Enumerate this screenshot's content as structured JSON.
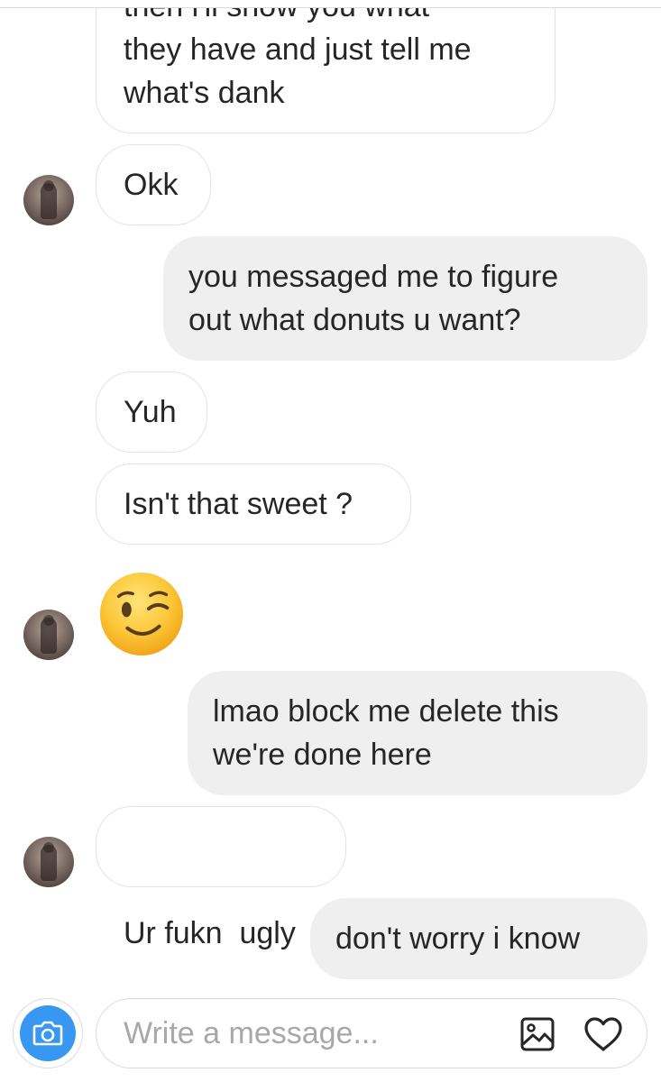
{
  "conversation": {
    "messages": [
      {
        "sender": "them",
        "lines": [
          "then i'll show you what",
          "they have and just tell me",
          "what's dank"
        ]
      },
      {
        "sender": "them",
        "lines": [
          "Okk"
        ],
        "avatar": true
      },
      {
        "sender": "me",
        "lines": [
          "you messaged me to figure",
          "out what donuts u want?"
        ]
      },
      {
        "sender": "them",
        "lines": [
          "Yuh"
        ]
      },
      {
        "sender": "them",
        "lines": [
          "Isn't that sweet ?"
        ]
      },
      {
        "sender": "them",
        "emoji": "winking-face",
        "avatar": true
      },
      {
        "sender": "me",
        "lines": [
          "lmao block me delete this",
          "we're done here"
        ]
      },
      {
        "sender": "them",
        "lines": [
          "Ur fukn  ugly"
        ],
        "avatar": true
      },
      {
        "sender": "me",
        "lines": [
          "don't worry i know"
        ]
      }
    ]
  },
  "composer": {
    "placeholder": "Write a message...",
    "camera_icon": "camera-icon",
    "gallery_icon": "gallery-icon",
    "like_icon": "heart-icon"
  },
  "colors": {
    "accent": "#3897f0",
    "outgoing_bubble": "#efefef",
    "incoming_border": "#e3e3e3",
    "text": "#262626",
    "placeholder": "#a8a8a8"
  }
}
